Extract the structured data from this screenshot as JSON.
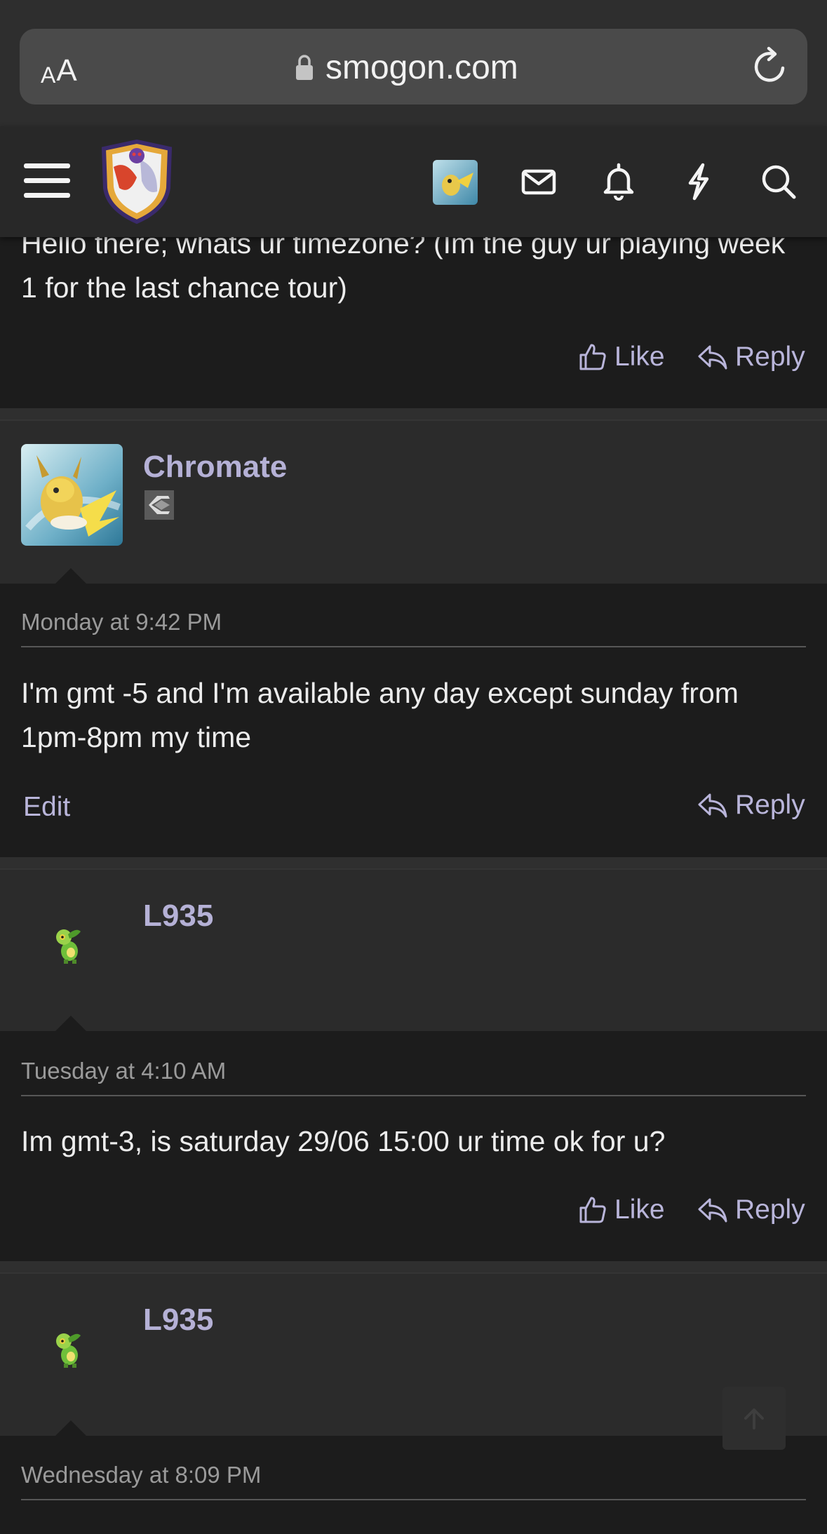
{
  "browser": {
    "text_size_label_small": "A",
    "text_size_label_large": "A",
    "url": "smogon.com"
  },
  "header": {
    "icons": [
      "menu-icon",
      "site-logo",
      "avatar",
      "envelope-icon",
      "bell-icon",
      "bolt-icon",
      "search-icon"
    ]
  },
  "posts": [
    {
      "message": "Hello there; whats ur timezone? (Im the guy ur playing week 1 for the last chance tour)",
      "like_label": "Like",
      "reply_label": "Reply"
    },
    {
      "username": "Chromate",
      "timestamp": "Monday at 9:42 PM",
      "message": "I'm gmt -5 and I'm available any day except sunday from 1pm-8pm my time",
      "edit_label": "Edit",
      "reply_label": "Reply"
    },
    {
      "username": "L935",
      "timestamp": "Tuesday at 4:10 AM",
      "message": "Im gmt-3, is saturday 29/06 15:00 ur time ok for u?",
      "like_label": "Like",
      "reply_label": "Reply"
    },
    {
      "username": "L935",
      "timestamp": "Wednesday at 8:09 PM"
    }
  ],
  "colors": {
    "accent": "#b5b1d6",
    "background": "#1c1c1c",
    "user_bar": "#2b2b2b"
  }
}
